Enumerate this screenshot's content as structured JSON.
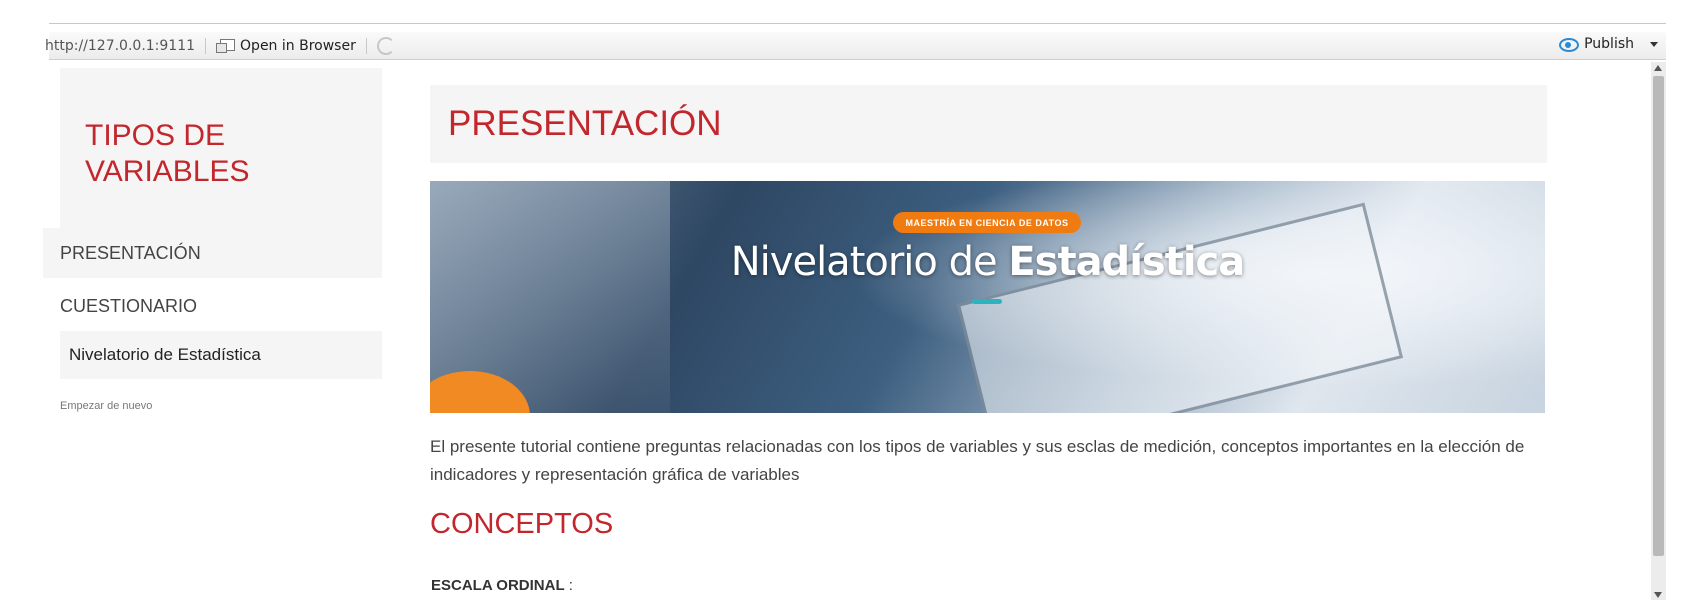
{
  "toolbar": {
    "url": "http://127.0.0.1:9111",
    "open_in_browser": "Open in Browser",
    "publish": "Publish"
  },
  "sidebar": {
    "title": "TIPOS DE VARIABLES",
    "items": [
      {
        "label": "PRESENTACIÓN"
      },
      {
        "label": "CUESTIONARIO"
      }
    ],
    "sub_item": "Nivelatorio de Estadística",
    "restart": "Empezar de nuevo"
  },
  "main": {
    "title": "PRESENTACIÓN",
    "banner": {
      "badge": "MAESTRÍA EN CIENCIA DE DATOS",
      "title_light": "Nivelatorio de ",
      "title_bold": "Estadística"
    },
    "intro": "El presente tutorial contiene preguntas relacionadas con los tipos de variables y sus esclas de medición, conceptos importantes en la elección de indicadores y representación gráfica de variables",
    "section_title": "CONCEPTOS",
    "term_label": "ESCALA ORDINAL",
    "term_suffix": " :"
  },
  "colors": {
    "accent": "#c3272e",
    "badge": "#f07c11",
    "publish_icon": "#2a8bd5"
  }
}
